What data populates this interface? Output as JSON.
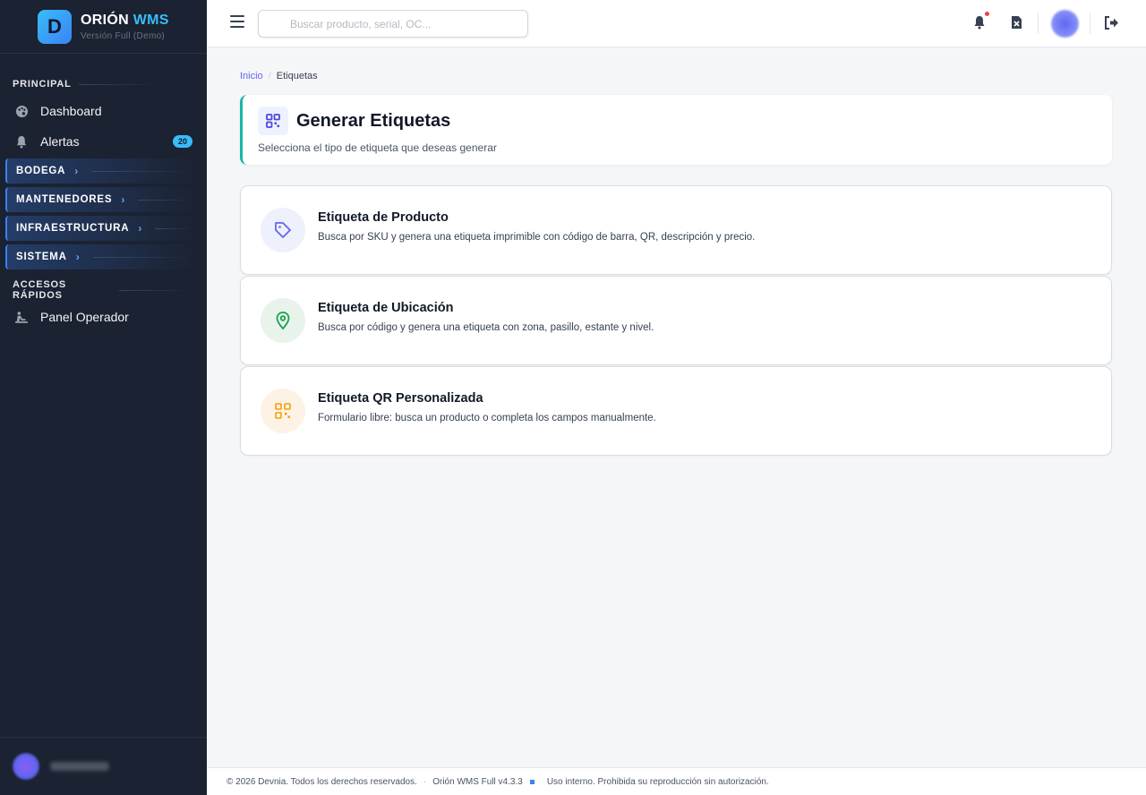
{
  "brand": {
    "logo_letter": "D",
    "name_main": "ORIÓN",
    "name_accent": "WMS",
    "subtitle": "Versión Full (Demo)"
  },
  "sidebar": {
    "section_principal": "PRINCIPAL",
    "items": [
      {
        "label": "Dashboard",
        "icon": "palette-icon"
      },
      {
        "label": "Alertas",
        "icon": "bell-icon",
        "badge": "20"
      }
    ],
    "groups": [
      "BODEGA",
      "MANTENEDORES",
      "INFRAESTRUCTURA",
      "SISTEMA"
    ],
    "section_quick": "ACCESOS RÁPIDOS",
    "quick_items": [
      {
        "label": "Panel Operador",
        "icon": "operator-icon"
      }
    ]
  },
  "topbar": {
    "search_placeholder": "Buscar producto, serial, OC..."
  },
  "breadcrumb": {
    "home": "Inicio",
    "separator": "/",
    "current": "Etiquetas"
  },
  "header": {
    "title": "Generar Etiquetas",
    "subtitle": "Selecciona el tipo de etiqueta que deseas generar"
  },
  "options": [
    {
      "title": "Etiqueta de Producto",
      "description": "Busca por SKU y genera una etiqueta imprimible con código de barra, QR, descripción y precio.",
      "icon": "tag-icon",
      "color": "#6366f1"
    },
    {
      "title": "Etiqueta de Ubicación",
      "description": "Busca por código y genera una etiqueta con zona, pasillo, estante y nivel.",
      "icon": "map-pin-icon",
      "color": "#16a34a"
    },
    {
      "title": "Etiqueta QR Personalizada",
      "description": "Formulario libre: busca un producto o completa los campos manualmente.",
      "icon": "qr-icon",
      "color": "#f59e0b"
    }
  ],
  "footer": {
    "copyright": "© 2026 Devnia. Todos los derechos reservados.",
    "separator": "·",
    "version": "Orión WMS Full v4.3.3",
    "notice": "Uso interno. Prohibida su reproducción sin autorización."
  },
  "colors": {
    "sidebar_bg": "#1b2231",
    "accent": "#38bdf8",
    "header_border": "#14b8a6"
  }
}
